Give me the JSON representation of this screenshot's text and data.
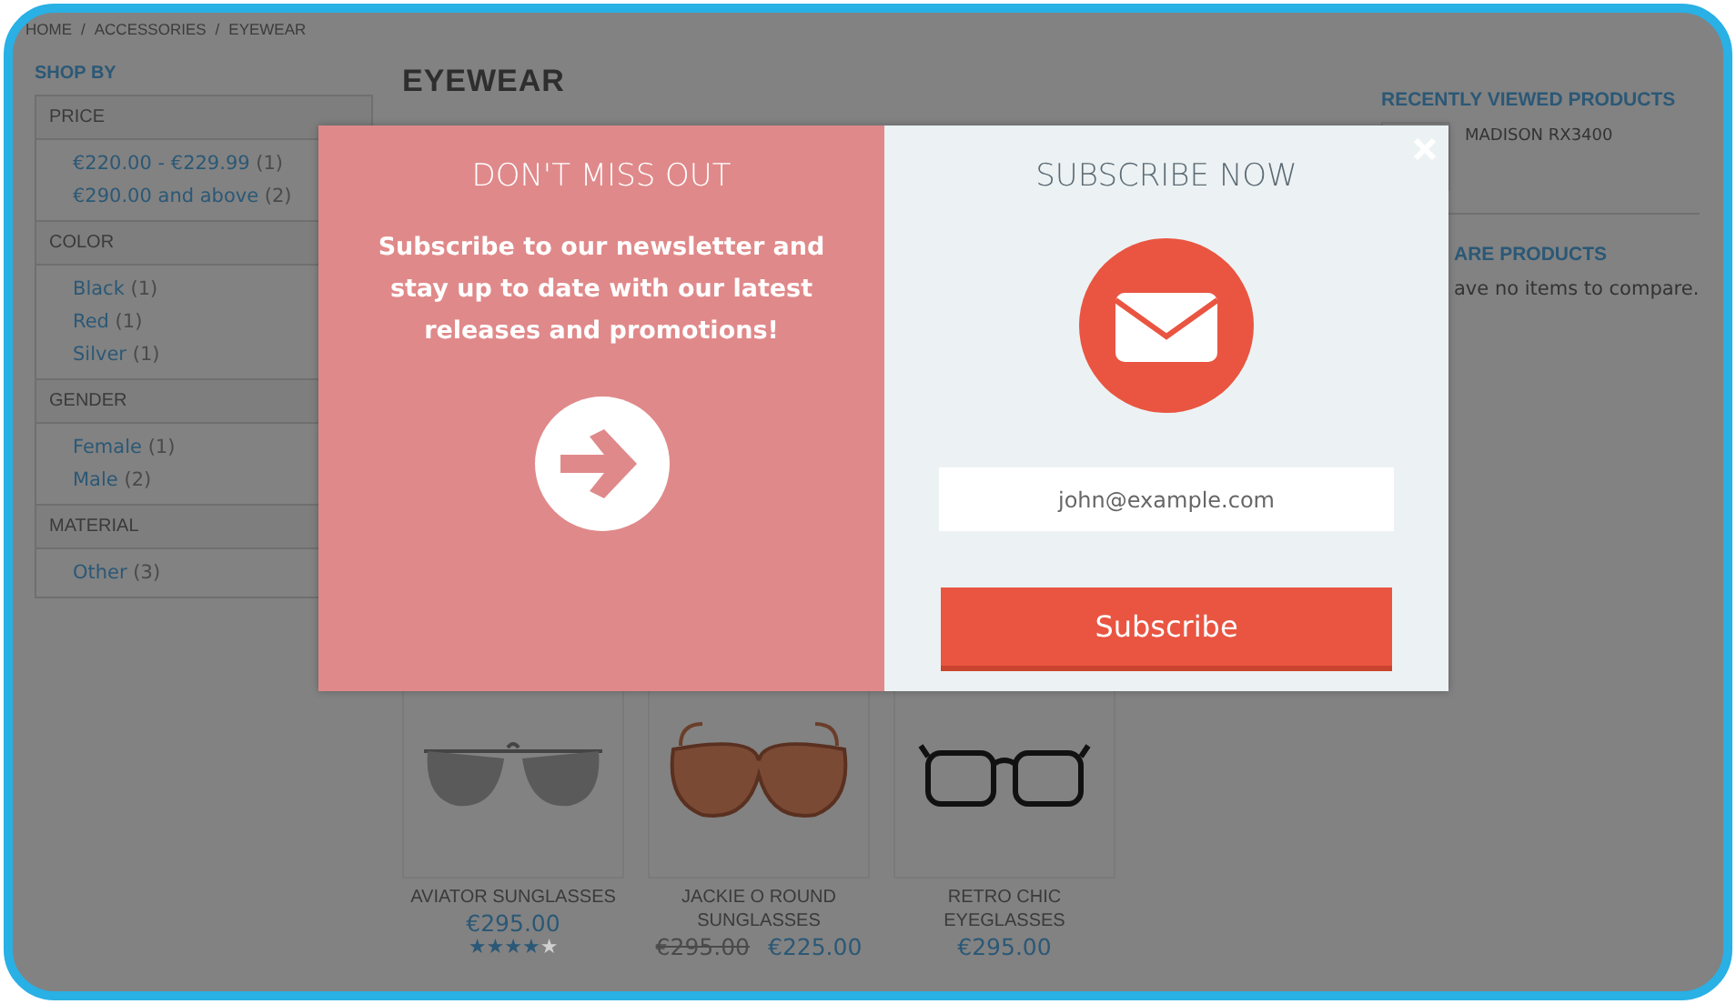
{
  "breadcrumb": {
    "items": [
      "HOME",
      "ACCESSORIES",
      "EYEWEAR"
    ],
    "separator": "/"
  },
  "sidebar": {
    "title": "SHOP BY",
    "sections": [
      {
        "title": "PRICE",
        "options": [
          {
            "label": "€220.00 - €229.99",
            "count": "(1)"
          },
          {
            "label": "€290.00 and above",
            "count": "(2)"
          }
        ]
      },
      {
        "title": "COLOR",
        "options": [
          {
            "label": "Black",
            "count": "(1)"
          },
          {
            "label": "Red",
            "count": "(1)"
          },
          {
            "label": "Silver",
            "count": "(1)"
          }
        ]
      },
      {
        "title": "GENDER",
        "options": [
          {
            "label": "Female",
            "count": "(1)"
          },
          {
            "label": "Male",
            "count": "(2)"
          }
        ]
      },
      {
        "title": "MATERIAL",
        "options": [
          {
            "label": "Other",
            "count": "(3)"
          }
        ]
      }
    ]
  },
  "page_title": "EYEWEAR",
  "products": [
    {
      "kind": "aviator",
      "name": "AVIATOR SUNGLASSES",
      "price": "€295.00",
      "stars": 4
    },
    {
      "kind": "oversized",
      "name": "JACKIE O ROUND SUNGLASSES",
      "old_price": "€295.00",
      "price": "€225.00"
    },
    {
      "kind": "square",
      "name": "RETRO CHIC EYEGLASSES",
      "price": "€295.00"
    }
  ],
  "recently_viewed": {
    "title": "RECENTLY VIEWED PRODUCTS",
    "items": [
      {
        "name": "MADISON RX3400"
      }
    ]
  },
  "compare": {
    "title": "ARE PRODUCTS",
    "message": "ave no items to compare."
  },
  "popup": {
    "title": "DON'T MISS OUT",
    "message": "Subscribe to our newsletter and stay up to date with our latest releases and promotions!",
    "form_title": "SUBSCRIBE NOW",
    "email": {
      "value": "john@example.com"
    },
    "button": "Subscribe"
  }
}
